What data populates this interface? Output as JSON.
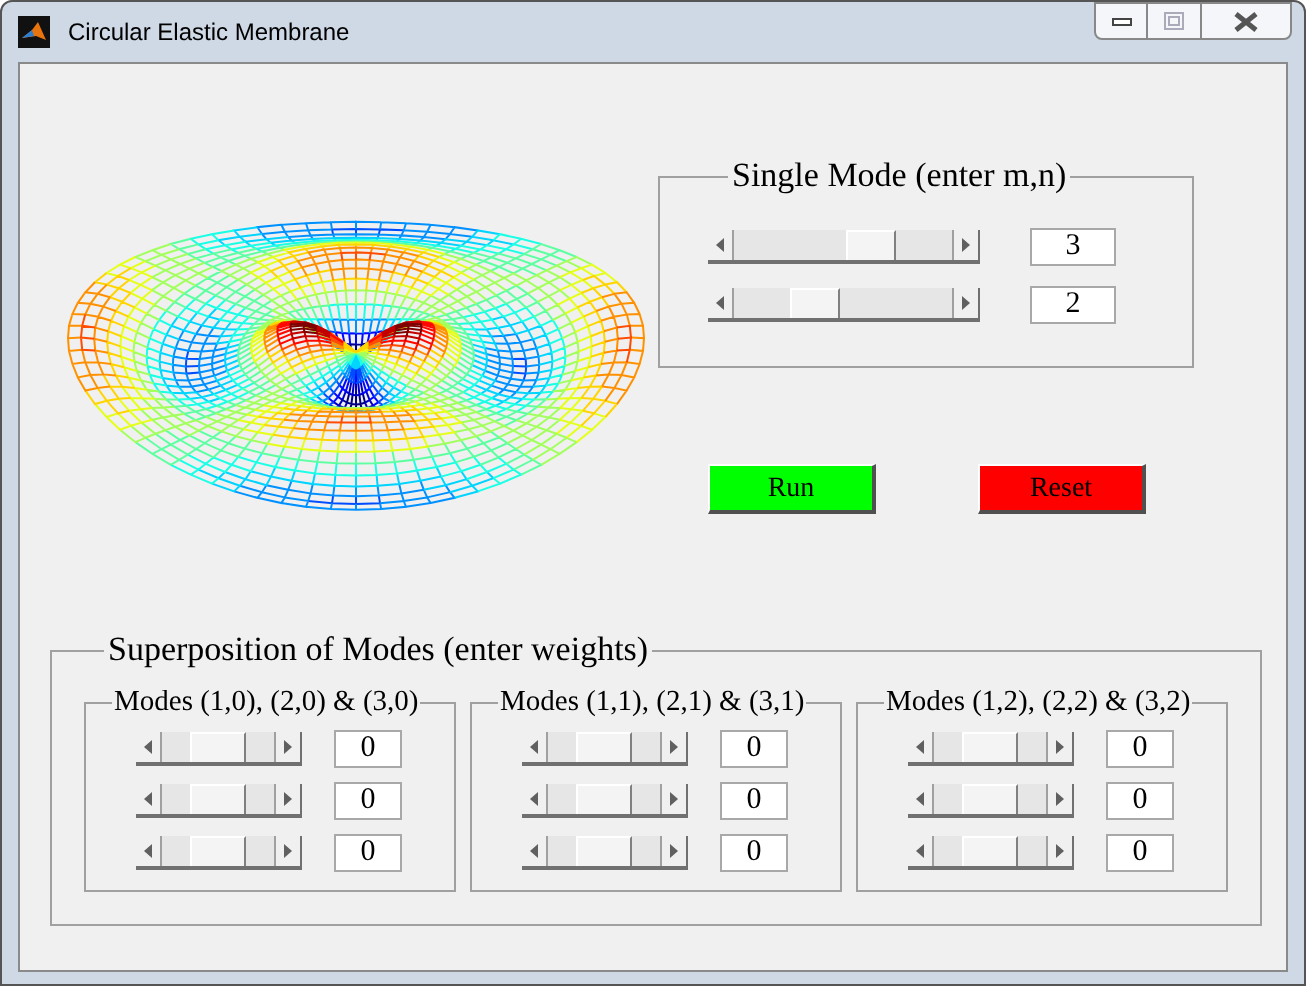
{
  "window": {
    "title": "Circular Elastic Membrane"
  },
  "single_mode": {
    "title": "Single Mode (enter m,n)",
    "sliders": [
      {
        "level": 0.67,
        "value": "3"
      },
      {
        "level": 0.33,
        "value": "2"
      }
    ]
  },
  "buttons": [
    {
      "label": "Run",
      "color": "#00ff00"
    },
    {
      "label": "Reset",
      "color": "#ff0000"
    }
  ],
  "superposition": {
    "title": "Superposition of Modes (enter weights)",
    "groups": [
      {
        "title": "Modes (1,0), (2,0) & (3,0)",
        "sliders": [
          {
            "level": 0.5,
            "value": "0"
          },
          {
            "level": 0.5,
            "value": "0"
          },
          {
            "level": 0.5,
            "value": "0"
          }
        ]
      },
      {
        "title": "Modes (1,1), (2,1) & (3,1)",
        "sliders": [
          {
            "level": 0.5,
            "value": "0"
          },
          {
            "level": 0.5,
            "value": "0"
          },
          {
            "level": 0.5,
            "value": "0"
          }
        ]
      },
      {
        "title": "Modes (1,2), (2,2) & (3,2)",
        "sliders": [
          {
            "level": 0.5,
            "value": "0"
          },
          {
            "level": 0.5,
            "value": "0"
          },
          {
            "level": 0.5,
            "value": "0"
          }
        ]
      }
    ]
  }
}
